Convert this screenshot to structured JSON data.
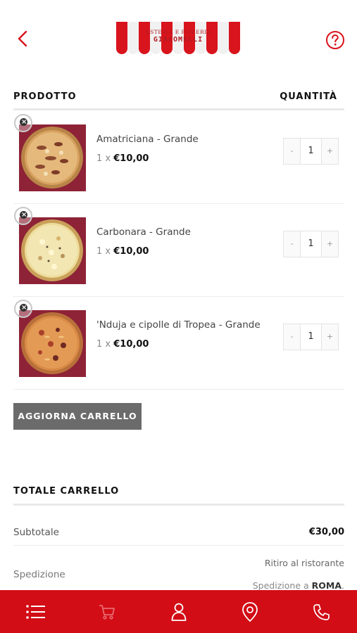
{
  "header": {
    "logo_line1": "OSTERIA E PIZZERIA",
    "logo_line2": "GIACOMELLI"
  },
  "table": {
    "col_product": "PRODOTTO",
    "col_quantity": "QUANTITÀ"
  },
  "cart_items": [
    {
      "name": "Amatriciana - Grande",
      "qty_prefix": "1 x",
      "price": "€10,00",
      "quantity": "1",
      "minus": "-",
      "plus": "+"
    },
    {
      "name": "Carbonara - Grande",
      "qty_prefix": "1 x",
      "price": "€10,00",
      "quantity": "1",
      "minus": "-",
      "plus": "+"
    },
    {
      "name": "'Nduja e cipolle di Tropea - Grande",
      "qty_prefix": "1 x",
      "price": "€10,00",
      "quantity": "1",
      "minus": "-",
      "plus": "+"
    }
  ],
  "actions": {
    "update_cart": "AGGIORNA CARRELLO"
  },
  "totals": {
    "title": "TOTALE CARRELLO",
    "subtotal_label": "Subtotale",
    "subtotal_value": "€30,00",
    "shipping_label": "Spedizione",
    "shipping_option1": "Ritiro al ristorante",
    "shipping_option2_prefix": "Spedizione a",
    "shipping_option2_city": "ROMA",
    "shipping_option2_suffix": "."
  },
  "tabbar": {
    "icons": [
      "menu-list-icon",
      "cart-icon",
      "user-icon",
      "location-pin-icon",
      "phone-icon"
    ]
  },
  "colors": {
    "brand_red": "#d20d16",
    "button_gray": "#6b6b6b",
    "pizza_bg": "#8e2236"
  }
}
